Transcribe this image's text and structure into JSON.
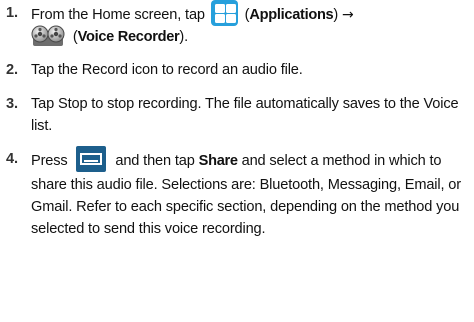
{
  "steps": [
    {
      "number": "1.",
      "text_a": "From the Home screen, tap ",
      "paren_open_a": " (",
      "icon_a_label": "Applications",
      "paren_close_a": ") ",
      "arrow": "→",
      "paren_open_b": " (",
      "icon_b_label": "Voice Recorder",
      "paren_close_b": ").",
      "icon_a": "applications-grid-icon",
      "icon_b": "voice-recorder-reel-icon"
    },
    {
      "number": "2.",
      "text": "Tap the Record icon to record an audio file."
    },
    {
      "number": "3.",
      "text": "Tap Stop to stop recording. The file automatically saves to the Voice list."
    },
    {
      "number": "4.",
      "text_a": "Press ",
      "icon": "menu-key-icon",
      "text_b": " and then tap ",
      "bold": "Share",
      "text_c": " and select a method in which to share this audio file. Selections are: Bluetooth, Messaging, Email, or Gmail. Refer to each specific section, depending on the method you selected to send this voice recording."
    }
  ],
  "colors": {
    "applications_icon": "#27a0dc",
    "menu_key_icon": "#1d5f8c",
    "text": "#111111"
  }
}
